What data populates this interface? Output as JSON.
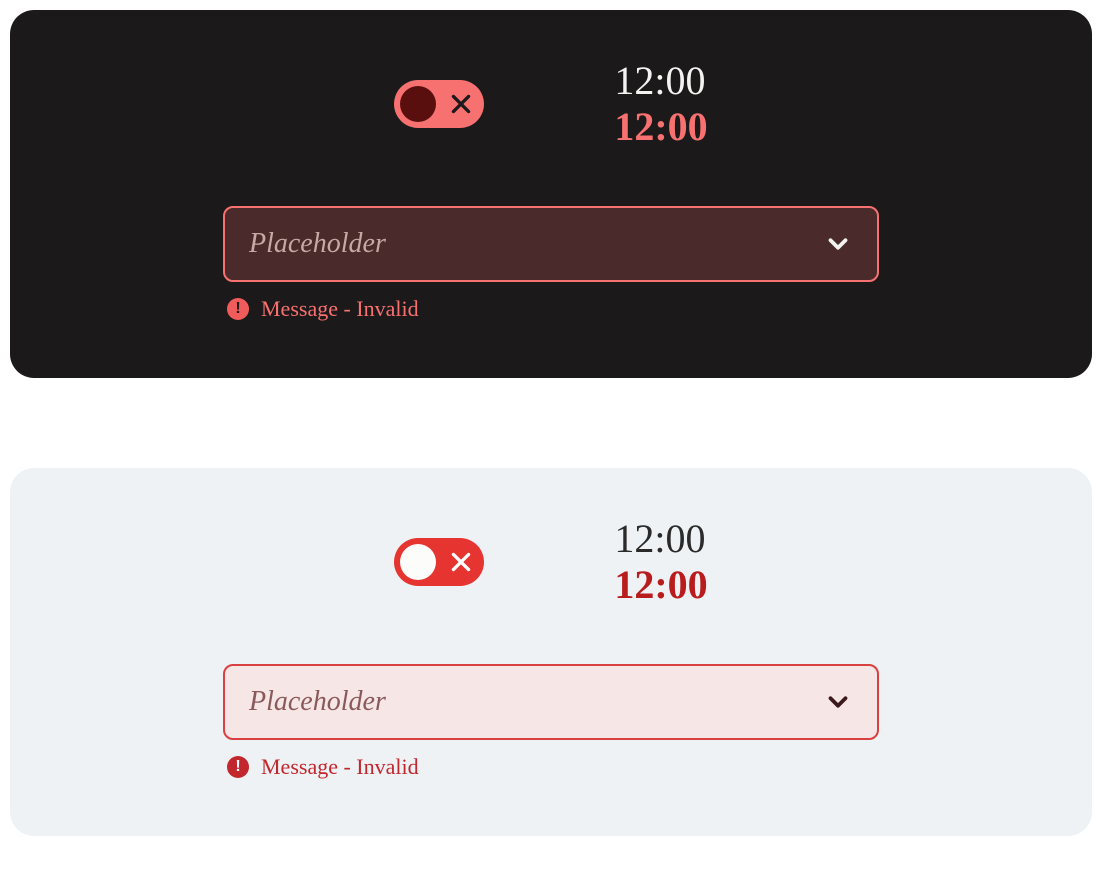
{
  "colors": {
    "dark_bg": "#1b1919",
    "light_bg": "#eff2f4",
    "accent_dark": "#f87171",
    "accent_light": "#e63431",
    "error_dark_text": "#f87171",
    "error_light_text": "#c1272d"
  },
  "dark": {
    "toggle_state": "off",
    "time_primary": "12:00",
    "time_secondary": "12:00",
    "dropdown": {
      "placeholder": "Placeholder",
      "value": ""
    },
    "validation_message": "Message - Invalid"
  },
  "light": {
    "toggle_state": "off",
    "time_primary": "12:00",
    "time_secondary": "12:00",
    "dropdown": {
      "placeholder": "Placeholder",
      "value": ""
    },
    "validation_message": "Message - Invalid"
  }
}
